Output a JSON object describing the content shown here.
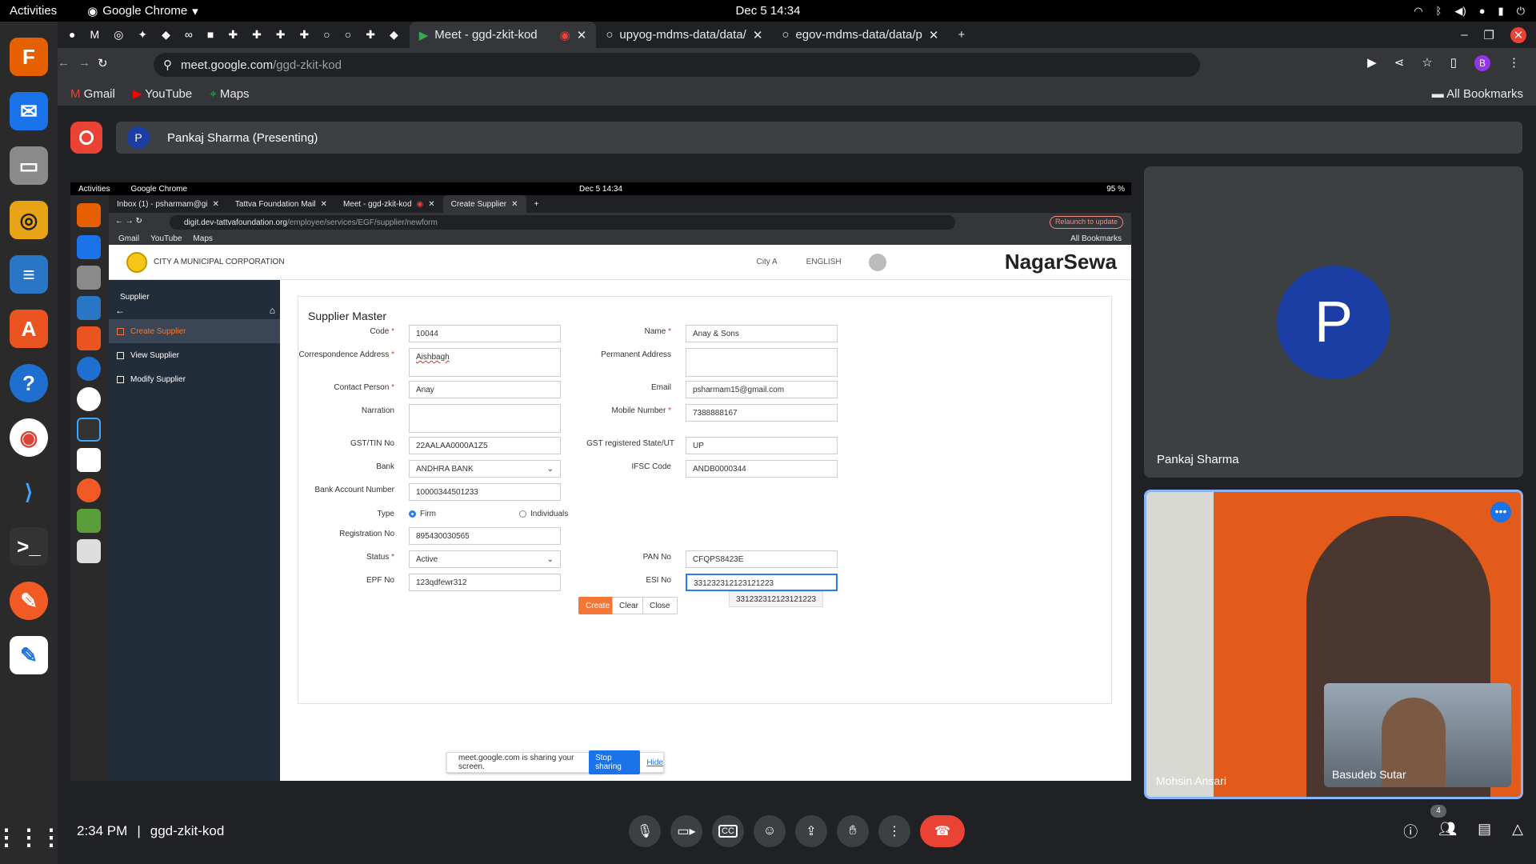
{
  "os": {
    "activities": "Activities",
    "app_name": "Google Chrome",
    "clock": "Dec 5  14:34"
  },
  "browser": {
    "tabs": [
      {
        "label": "Meet - ggd-zkit-kod",
        "active": true
      },
      {
        "label": "upyog-mdms-data/data/",
        "active": false
      },
      {
        "label": "egov-mdms-data/data/p",
        "active": false
      }
    ],
    "url_host": "meet.google.com",
    "url_path": "/ggd-zkit-kod",
    "bookmarks": [
      "Gmail",
      "YouTube",
      "Maps"
    ],
    "all_bookmarks": "All Bookmarks",
    "profile_initial": "B"
  },
  "meet": {
    "presenter": "Pankaj Sharma (Presenting)",
    "presenter_initial": "P",
    "time": "2:34 PM",
    "meeting_code": "ggd-zkit-kod",
    "participant_count": "4",
    "tiles": [
      {
        "name": "Pankaj Sharma",
        "initial": "P"
      },
      {
        "name": "Mohsin Ansari"
      },
      {
        "name": "Basudeb Sutar"
      }
    ]
  },
  "shared_screen": {
    "os": {
      "activities": "Activities",
      "app_name": "Google Chrome",
      "clock": "Dec 5  14:34",
      "battery": "95 %"
    },
    "tabs": [
      {
        "label": "Inbox (1) - psharmam@gi"
      },
      {
        "label": "Tattva Foundation Mail"
      },
      {
        "label": "Meet - ggd-zkit-kod"
      },
      {
        "label": "Create Supplier",
        "active": true
      }
    ],
    "url_host": "digit.dev-tattvafoundation.org",
    "url_path": "/employee/services/EGF/supplier/newform",
    "relaunch": "Relaunch to update",
    "bookmarks": [
      "Gmail",
      "YouTube",
      "Maps"
    ],
    "all_bookmarks": "All Bookmarks",
    "org": "CITY A MUNICIPAL CORPORATION",
    "city": "City A",
    "language": "ENGLISH",
    "brand": "NagarSewa",
    "sidebar": {
      "title": "Supplier",
      "items": [
        "Create Supplier",
        "View Supplier",
        "Modify Supplier"
      ]
    },
    "form": {
      "title": "Supplier Master",
      "code_label": "Code",
      "code": "10044",
      "name_label": "Name",
      "name": "Anay & Sons",
      "corr_label": "Correspondence Address",
      "corr": "Aishbagh",
      "perm_label": "Permanent Address",
      "perm": "",
      "contact_label": "Contact Person",
      "contact": "Anay",
      "email_label": "Email",
      "email": "psharmam15@gmail.com",
      "narration_label": "Narration",
      "narration": "",
      "mobile_label": "Mobile Number",
      "mobile": "7388888167",
      "gst_label": "GST/TIN No",
      "gst": "22AALAA0000A1Z5",
      "gst_state_label": "GST registered State/UT",
      "gst_state": "UP",
      "bank_label": "Bank",
      "bank": "ANDHRA BANK",
      "ifsc_label": "IFSC Code",
      "ifsc": "ANDB0000344",
      "acct_label": "Bank Account Number",
      "acct": "10000344501233",
      "type_label": "Type",
      "type_firm": "Firm",
      "type_ind": "Individuals",
      "reg_label": "Registration No",
      "reg": "895430030565",
      "status_label": "Status",
      "status": "Active",
      "pan_label": "PAN No",
      "pan": "CFQPS8423E",
      "epf_label": "EPF No",
      "epf": "123qdfewr312",
      "esi_label": "ESI No",
      "esi": "331232312123121223",
      "suggestion": "331232312123121223",
      "create": "Create",
      "clear": "Clear",
      "close": "Close"
    },
    "sharebar": {
      "text": "meet.google.com is sharing your screen.",
      "stop": "Stop sharing",
      "hide": "Hide"
    }
  }
}
